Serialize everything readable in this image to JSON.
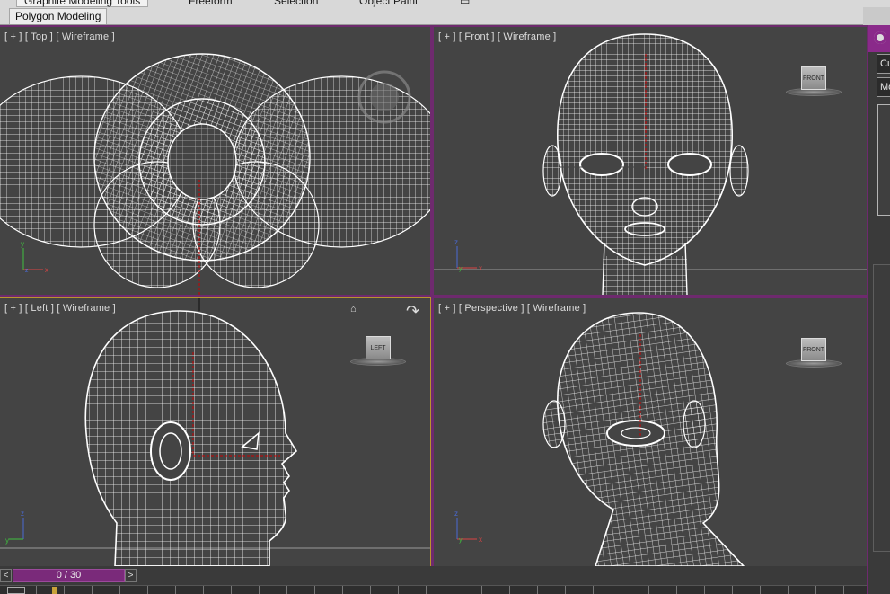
{
  "ribbon": {
    "tabs": [
      "Graphite Modeling Tools",
      "Freeform",
      "Selection",
      "Object Paint"
    ],
    "active_panel": "Polygon Modeling"
  },
  "viewports": {
    "top": {
      "label": "[ + ] [ Top ] [ Wireframe ]"
    },
    "front": {
      "label": "[ + ] [ Front ] [ Wireframe ]",
      "cube": "FRONT"
    },
    "left": {
      "label": "[ + ] [ Left ] [ Wireframe ]",
      "cube": "LEFT"
    },
    "perspective": {
      "label": "[ + ] [ Perspective ] [ Wireframe ]",
      "cube": "FRONT"
    }
  },
  "command_panel": {
    "field1": "Cu",
    "field2": "Mo"
  },
  "time_slider": {
    "prev": "<",
    "next": ">",
    "frame_text": "0 / 30"
  },
  "colors": {
    "viewport_bg": "#444444",
    "active_border": "#c8a23a",
    "frame_purple": "#6e2a6e",
    "wire": "#ffffff"
  }
}
